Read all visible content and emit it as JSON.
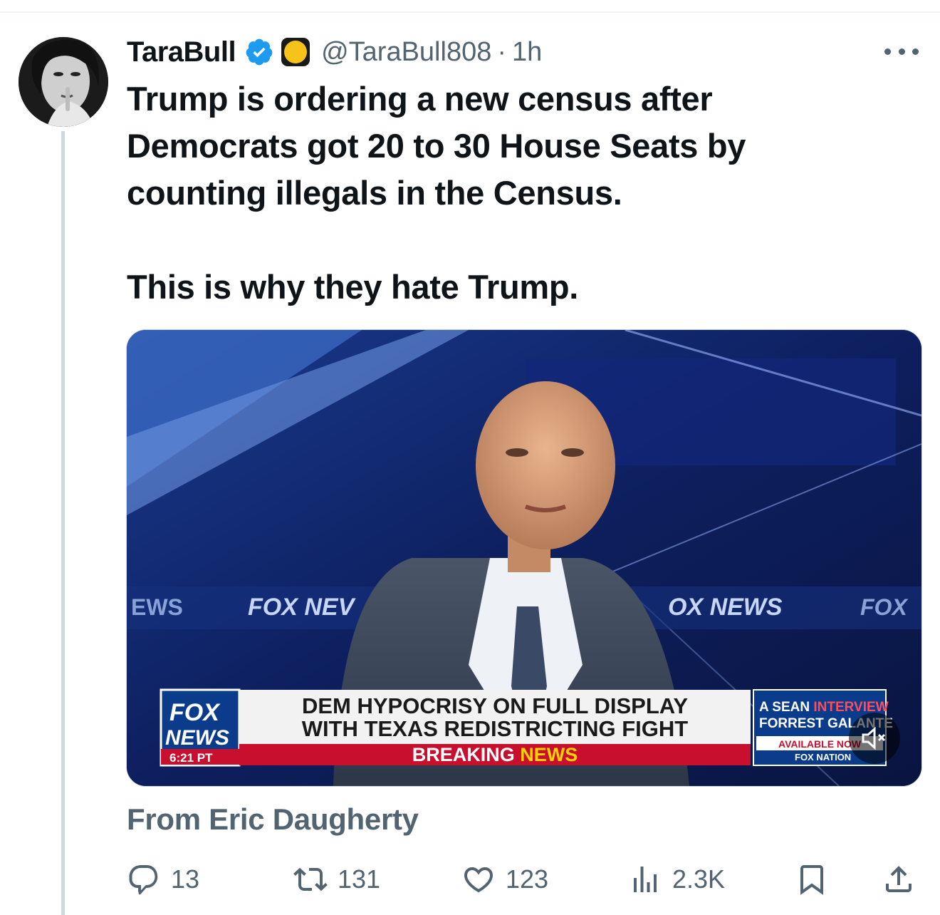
{
  "tweet": {
    "author_name": "TaraBull",
    "handle": "@TaraBull808",
    "separator": "·",
    "time": "1h",
    "text_line_1": "Trump is ordering a new census after",
    "text_line_2": "Democrats got 20 to 30 House Seats by",
    "text_line_3": "counting illegals in the Census.",
    "text_line_4": "This is why they hate Trump.",
    "source": "From Eric Daugherty"
  },
  "video": {
    "backdrop_text_1": "EWS",
    "backdrop_text_2": "FOX NEV",
    "backdrop_text_3": "OX NEWS",
    "backdrop_text_4": "FOX",
    "logo_top": "FOX",
    "logo_bottom": "NEWS",
    "clock": "6:21 PT",
    "headline_1": "DEM HYPOCRISY ON FULL DISPLAY",
    "headline_2": "WITH TEXAS REDISTRICTING FIGHT",
    "breaking_1": "BREAKING",
    "breaking_2": "NEWS",
    "promo_1a": "A SEAN",
    "promo_1b": "INTERVIEW",
    "promo_2": "FORREST GALANTE",
    "promo_3": "AVAILABLE NOW",
    "promo_4": "FOX NATION",
    "muted": true
  },
  "actions": {
    "replies": "13",
    "reposts": "131",
    "likes": "123",
    "views": "2.3K"
  },
  "colors": {
    "verified": "#1d9bf0",
    "secondary_text": "#536471",
    "fox_red": "#c8102e",
    "fox_blue": "#0b3c8c",
    "breaking_yellow": "#ffd200"
  },
  "icons": [
    "verified-badge-icon",
    "yellow-circle-emoji-icon",
    "more-icon",
    "reply-icon",
    "repost-icon",
    "like-icon",
    "views-icon",
    "bookmark-icon",
    "share-icon",
    "mute-icon"
  ]
}
